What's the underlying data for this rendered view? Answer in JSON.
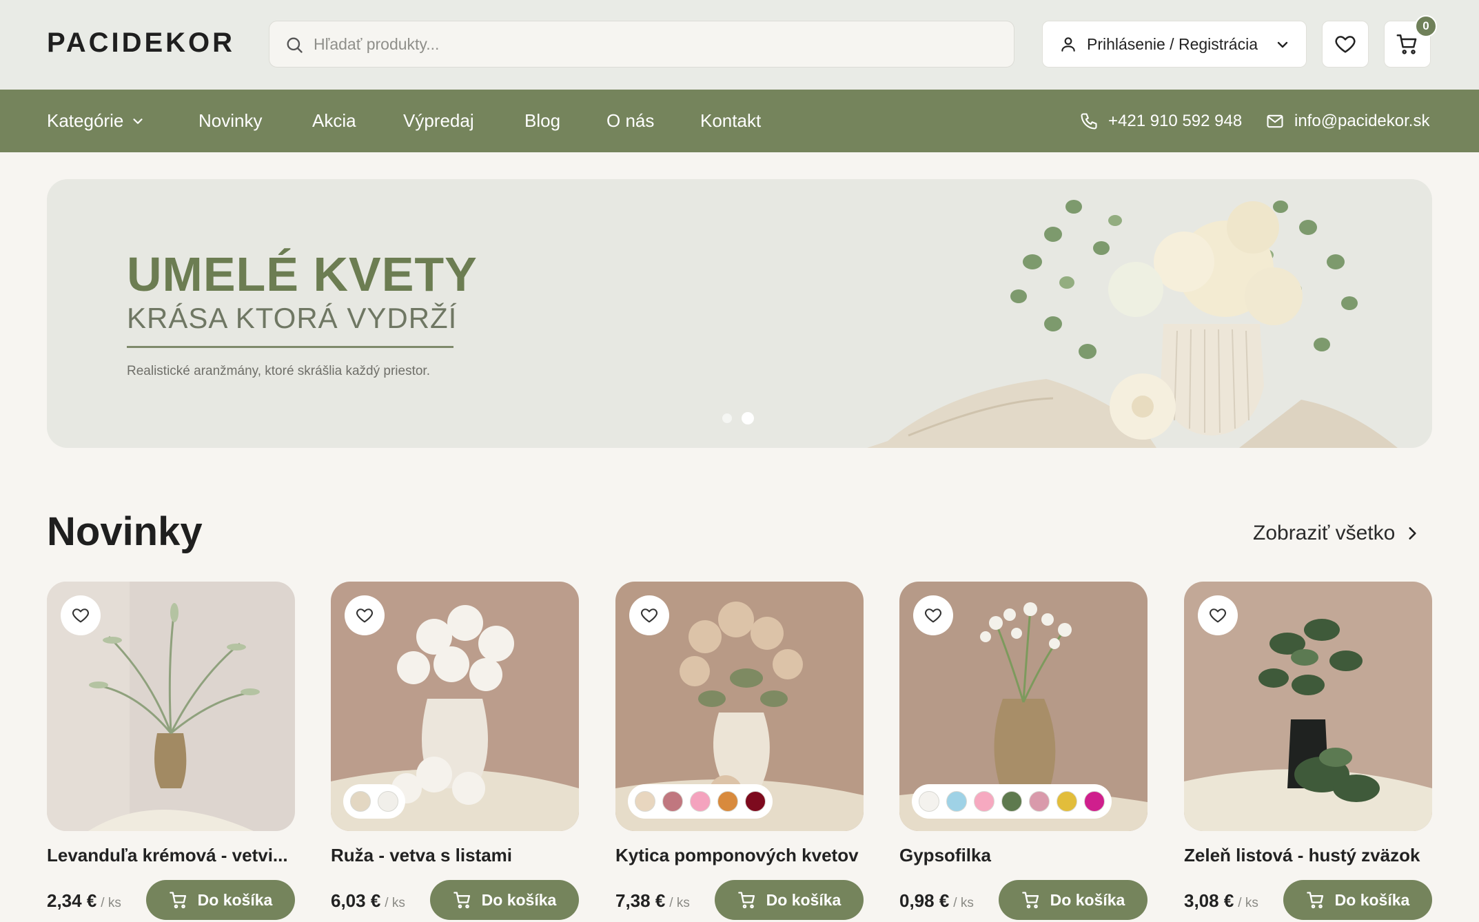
{
  "header": {
    "logo": "PACIDEKOR",
    "search_placeholder": "Hľadať produkty...",
    "login_label": "Prihlásenie / Registrácia",
    "cart_count": "0"
  },
  "nav": {
    "categories": "Kategórie",
    "news": "Novinky",
    "sale": "Akcia",
    "clearance": "Výpredaj",
    "blog": "Blog",
    "about": "O nás",
    "contact": "Kontakt",
    "phone": "+421 910 592 948",
    "email": "info@pacidekor.sk"
  },
  "hero": {
    "title": "UMELÉ KVETY",
    "subtitle": "KRÁSA KTORÁ VYDRŽÍ",
    "description": "Realistické aranžmány, ktoré skrášlia každý priestor.",
    "slides": 2,
    "active_slide": 2
  },
  "section": {
    "title": "Novinky",
    "see_all": "Zobraziť všetko"
  },
  "buy_label": "Do košíka",
  "products": [
    {
      "name": "Levanduľa krémová - vetvi...",
      "price": "2,34 €",
      "unit": "/ ks",
      "swatches": []
    },
    {
      "name": "Ruža - vetva s listami",
      "price": "6,03 €",
      "unit": "/ ks",
      "swatches": [
        "#e3d7c2",
        "#f1efea"
      ]
    },
    {
      "name": "Kytica pomponových kvetov",
      "price": "7,38 €",
      "unit": "/ ks",
      "swatches": [
        "#e8d6bf",
        "#c0777f",
        "#f4a3be",
        "#d88a3d",
        "#7d0a1e"
      ]
    },
    {
      "name": "Gypsofilka",
      "price": "0,98 €",
      "unit": "/ ks",
      "swatches": [
        "#f4f2ee",
        "#9fd2e6",
        "#f6a9c0",
        "#5e7a4e",
        "#d99aab",
        "#e2bd3b",
        "#cf1f8d"
      ]
    },
    {
      "name": "Zeleň listová - hustý zväzok",
      "price": "3,08 €",
      "unit": "/ ks",
      "swatches": []
    }
  ],
  "colors": {
    "brand_green": "#75845c",
    "header_bg": "#e9ebe6",
    "page_bg": "#f7f5f1",
    "hero_title": "#6c7d52"
  }
}
